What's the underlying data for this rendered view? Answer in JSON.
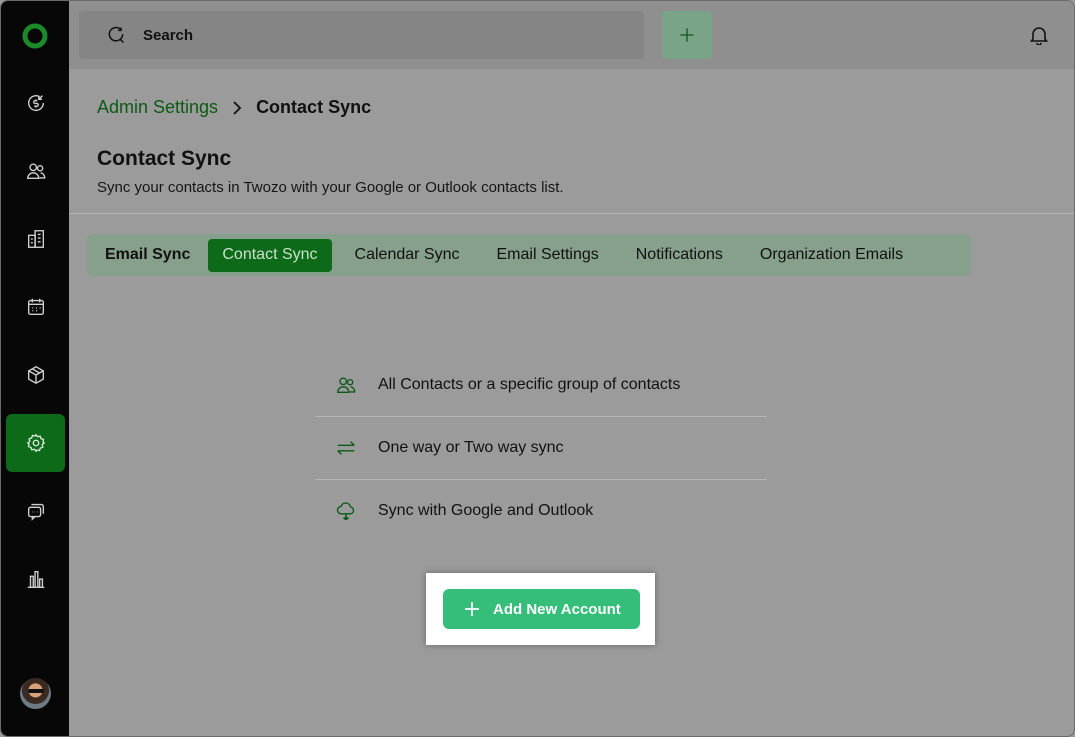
{
  "search": {
    "placeholder": "Search"
  },
  "breadcrumb": {
    "parent": "Admin Settings",
    "current": "Contact Sync"
  },
  "page": {
    "title": "Contact Sync",
    "subtitle": "Sync your contacts in Twozo with your Google or Outlook contacts list."
  },
  "tabs": [
    {
      "label": "Email Sync",
      "active": false
    },
    {
      "label": "Contact Sync",
      "active": true
    },
    {
      "label": "Calendar Sync",
      "active": false
    },
    {
      "label": "Email Settings",
      "active": false
    },
    {
      "label": "Notifications",
      "active": false
    },
    {
      "label": "Organization Emails",
      "active": false
    }
  ],
  "features": [
    {
      "icon": "contacts-icon",
      "text": "All Contacts or a specific group of contacts"
    },
    {
      "icon": "swap-arrows-icon",
      "text": "One way or Two way sync"
    },
    {
      "icon": "cloud-icon",
      "text": "Sync with Google and Outlook"
    }
  ],
  "add_button": {
    "label": "Add New Account"
  },
  "sidebar": {
    "items": [
      "deals-icon",
      "contacts-icon",
      "companies-icon",
      "calendar-icon",
      "products-icon",
      "settings-icon",
      "conversations-icon",
      "reports-icon"
    ],
    "active": "settings-icon"
  },
  "colors": {
    "accent": "#0d6a18",
    "button": "#35be7a",
    "sidebar": "#070707"
  }
}
